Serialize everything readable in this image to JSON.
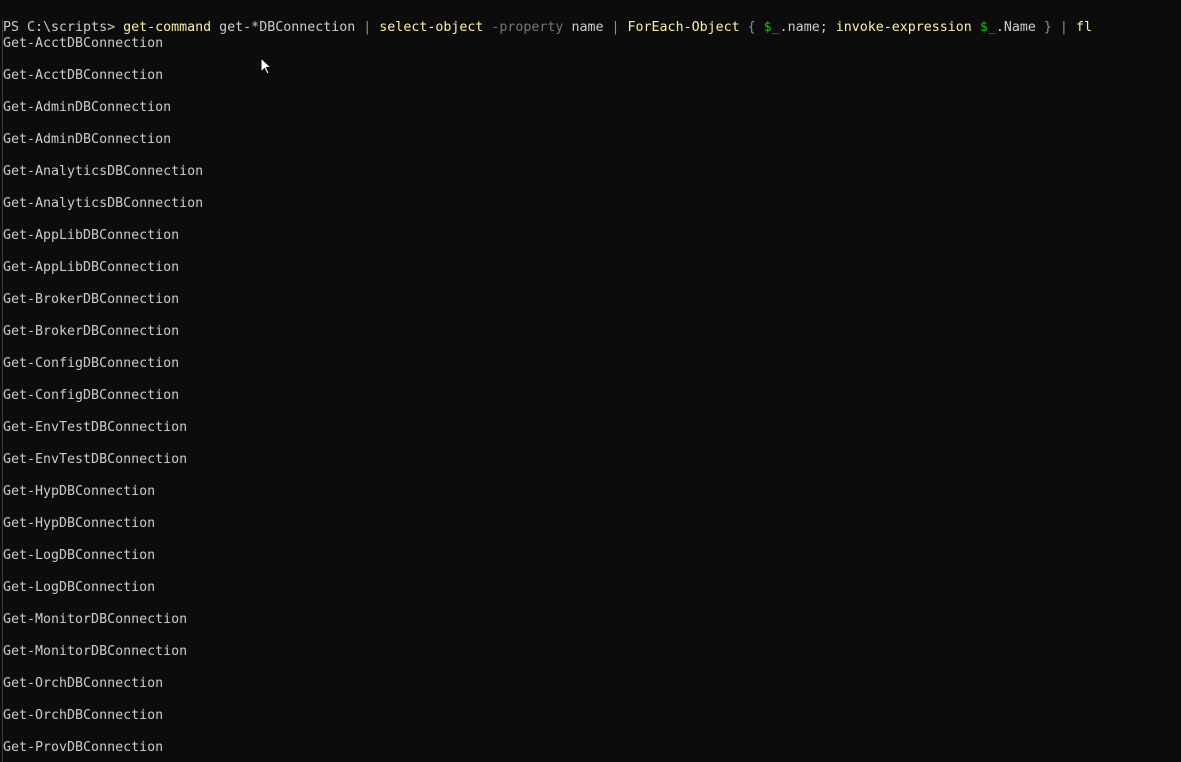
{
  "prompt": "PS C:\\scripts> ",
  "command": {
    "tokens": [
      {
        "text": "get-command",
        "type": "cmd"
      },
      {
        "text": " get-*DBConnection ",
        "type": "arg"
      },
      {
        "text": "|",
        "type": "op"
      },
      {
        "text": " ",
        "type": "arg"
      },
      {
        "text": "select-object",
        "type": "cmd"
      },
      {
        "text": " ",
        "type": "arg"
      },
      {
        "text": "-property",
        "type": "param"
      },
      {
        "text": " name ",
        "type": "arg"
      },
      {
        "text": "|",
        "type": "op"
      },
      {
        "text": " ",
        "type": "arg"
      },
      {
        "text": "ForEach-Object",
        "type": "cmd"
      },
      {
        "text": " ",
        "type": "arg"
      },
      {
        "text": "{",
        "type": "op"
      },
      {
        "text": " ",
        "type": "arg"
      },
      {
        "text": "$_",
        "type": "var"
      },
      {
        "text": ".name; ",
        "type": "arg"
      },
      {
        "text": "invoke-expression",
        "type": "cmd"
      },
      {
        "text": " ",
        "type": "arg"
      },
      {
        "text": "$_",
        "type": "var"
      },
      {
        "text": ".Name ",
        "type": "arg"
      },
      {
        "text": "}",
        "type": "op"
      },
      {
        "text": " ",
        "type": "arg"
      },
      {
        "text": "|",
        "type": "op"
      },
      {
        "text": " ",
        "type": "arg"
      },
      {
        "text": "fl",
        "type": "cmd"
      }
    ]
  },
  "output": [
    "Get-AcctDBConnection",
    "Get-AcctDBConnection",
    "Get-AdminDBConnection",
    "Get-AdminDBConnection",
    "Get-AnalyticsDBConnection",
    "Get-AnalyticsDBConnection",
    "Get-AppLibDBConnection",
    "Get-AppLibDBConnection",
    "Get-BrokerDBConnection",
    "Get-BrokerDBConnection",
    "Get-ConfigDBConnection",
    "Get-ConfigDBConnection",
    "Get-EnvTestDBConnection",
    "Get-EnvTestDBConnection",
    "Get-HypDBConnection",
    "Get-HypDBConnection",
    "Get-LogDBConnection",
    "Get-LogDBConnection",
    "Get-MonitorDBConnection",
    "Get-MonitorDBConnection",
    "Get-OrchDBConnection",
    "Get-OrchDBConnection",
    "Get-ProvDBConnection"
  ],
  "colors": {
    "background": "#0c0c0c",
    "text": "#cccccc",
    "command": "#f9f1a5",
    "operator": "#7f8fb0",
    "parameter": "#767676",
    "variable": "#16c60c"
  },
  "icons": {
    "cursor": "mouse-pointer-icon"
  }
}
